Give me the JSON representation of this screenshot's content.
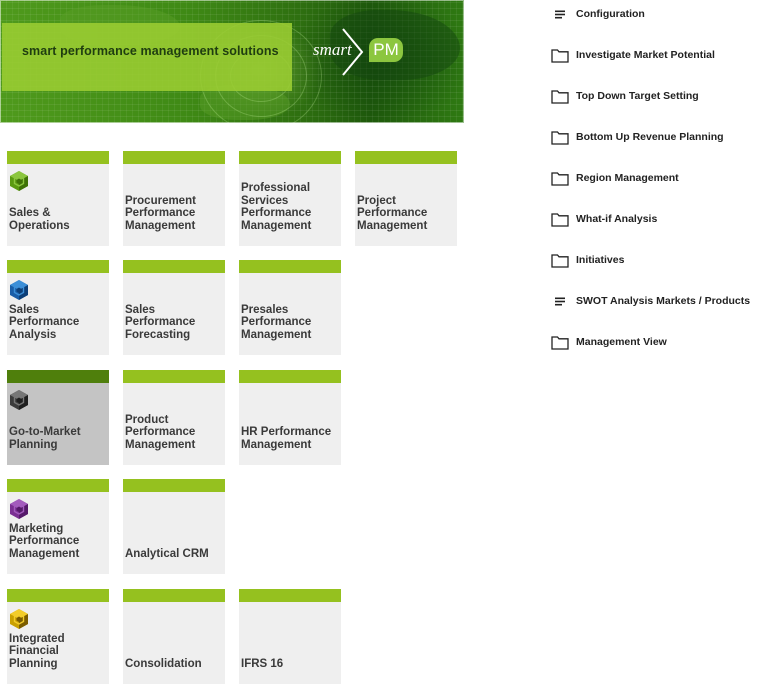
{
  "banner": {
    "tagline": "smart performance management solutions",
    "logo_word": "smart",
    "logo_badge": "PM"
  },
  "colors": {
    "tile_bar": "#95c11f",
    "tile_bar_active": "#4f7f0c",
    "tile_body": "#efefef",
    "tile_body_active": "#c4c4c4",
    "icon_green": "#6fae1c",
    "icon_blue": "#1a5ea8",
    "icon_grey": "#3c3c3c",
    "icon_purple": "#7b2f93",
    "icon_gold": "#c9a000"
  },
  "tiles": [
    {
      "label": "Sales & Operations",
      "icon": "cube-icon-green",
      "active": false
    },
    {
      "label": "Procurement Performance Management",
      "icon": null,
      "active": false
    },
    {
      "label": "Professional Services Performance Management",
      "icon": null,
      "active": false
    },
    {
      "label": "Project Performance Management",
      "icon": null,
      "active": false
    },
    {
      "label": "Sales Performance Analysis",
      "icon": "cube-icon-blue",
      "active": false
    },
    {
      "label": "Sales Performance Forecasting",
      "icon": null,
      "active": false
    },
    {
      "label": "Presales Performance Management",
      "icon": null,
      "active": false
    },
    {
      "label": "Go-to-Market Planning",
      "icon": "cube-icon-grey",
      "active": true
    },
    {
      "label": "Product Performance Management",
      "icon": null,
      "active": false
    },
    {
      "label": "HR Performance Management",
      "icon": null,
      "active": false
    },
    {
      "label": "Marketing Performance Management",
      "icon": "cube-icon-purple",
      "active": false
    },
    {
      "label": "Analytical CRM",
      "icon": null,
      "active": false
    },
    {
      "label": "Integrated Financial Planning",
      "icon": "cube-icon-gold",
      "active": false
    },
    {
      "label": "Consolidation",
      "icon": null,
      "active": false
    },
    {
      "label": "IFRS 16",
      "icon": null,
      "active": false
    }
  ],
  "menu": {
    "items": [
      {
        "label": "Configuration",
        "icon": "list-icon"
      },
      {
        "label": "Investigate Market Potential",
        "icon": "folder-icon"
      },
      {
        "label": "Top Down Target Setting",
        "icon": "folder-icon"
      },
      {
        "label": "Bottom Up Revenue Planning",
        "icon": "folder-icon"
      },
      {
        "label": "Region Management",
        "icon": "folder-icon"
      },
      {
        "label": "What-if Analysis",
        "icon": "folder-icon"
      },
      {
        "label": "Initiatives",
        "icon": "folder-icon"
      },
      {
        "label": "SWOT Analysis Markets / Products",
        "icon": "list-icon"
      },
      {
        "label": "Management View",
        "icon": "folder-icon"
      }
    ]
  }
}
